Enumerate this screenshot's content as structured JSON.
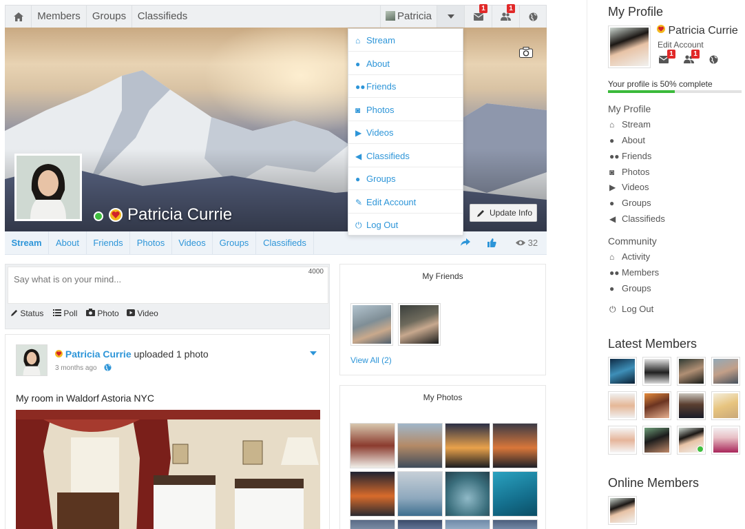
{
  "topnav": {
    "members": "Members",
    "groups": "Groups",
    "classifieds": "Classifieds",
    "user_name": "Patricia",
    "mail_count": "1",
    "friend_req_count": "1"
  },
  "cover": {
    "profile_name": "Patricia Currie",
    "update_info": "Update Info"
  },
  "dropdown": {
    "items": [
      "Stream",
      "About",
      "Friends",
      "Photos",
      "Videos",
      "Classifieds",
      "Groups",
      "Edit Account",
      "Log Out"
    ]
  },
  "tabs": {
    "items": [
      "Stream",
      "About",
      "Friends",
      "Photos",
      "Videos",
      "Groups",
      "Classifieds"
    ],
    "view_count": "32"
  },
  "status": {
    "placeholder": "Say what is on your mind...",
    "char_limit": "4000",
    "options": [
      "Status",
      "Poll",
      "Photo",
      "Video"
    ]
  },
  "post": {
    "author": "Patricia Currie",
    "action": "uploaded 1 photo",
    "time": "3 months ago",
    "text": "My room in Waldorf Astoria NYC"
  },
  "friends_widget": {
    "title": "My Friends",
    "view_all": "View All (2)"
  },
  "photos_widget": {
    "title": "My Photos"
  },
  "sidebar": {
    "my_profile_heading": "My Profile",
    "name": "Patricia Currie",
    "edit_account": "Edit Account",
    "mail_count": "1",
    "friend_req_count": "1",
    "profile_complete_text": "Your profile is 50% complete",
    "profile_complete_pct": 50,
    "profile_section": "My Profile",
    "profile_links": [
      "Stream",
      "About",
      "Friends",
      "Photos",
      "Videos",
      "Groups",
      "Classifieds"
    ],
    "community_section": "Community",
    "community_links": [
      "Activity",
      "Members",
      "Groups"
    ],
    "logout": "Log Out",
    "latest_members_heading": "Latest Members",
    "online_members_heading": "Online Members"
  },
  "colors": {
    "link": "#2d95d8",
    "badge": "#e12929",
    "online": "#3fbf3f",
    "progress": "#3bba3b"
  }
}
